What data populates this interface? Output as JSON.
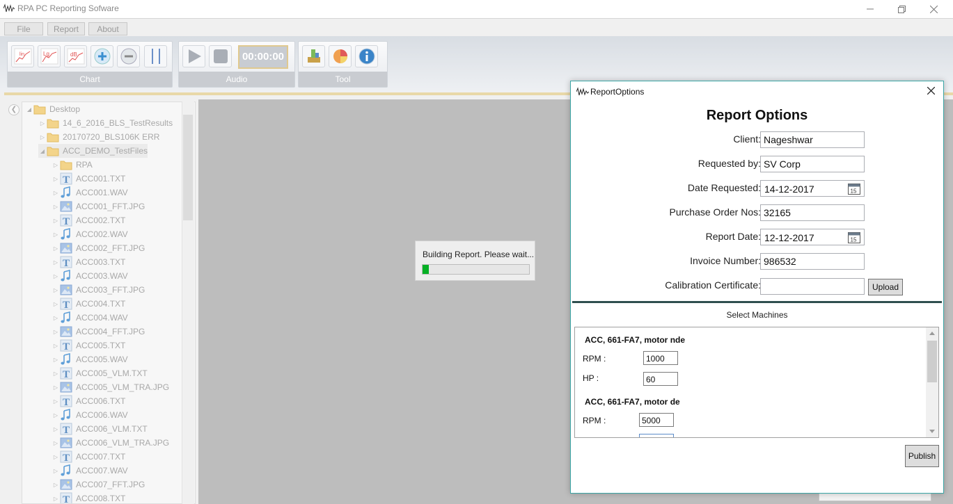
{
  "window": {
    "title": "RPA PC Reporting Sofware",
    "icon": "waveform-icon"
  },
  "menu": [
    "File",
    "Report",
    "About"
  ],
  "ribbon": {
    "chart_label": "Chart",
    "audio_label": "Audio",
    "tool_label": "Tool",
    "timer": "00:00:00",
    "chart_buttons": [
      {
        "icon": "linear-scale-icon",
        "text": "lin"
      },
      {
        "icon": "log-scale-icon",
        "text": "Lg"
      },
      {
        "icon": "db-scale-icon",
        "text": "dB"
      },
      {
        "icon": "zoom-in-icon"
      },
      {
        "icon": "zoom-out-icon"
      },
      {
        "icon": "cursor-lines-icon"
      }
    ]
  },
  "tree": {
    "root": "Desktop",
    "folders": [
      "14_6_2016_BLS_TestResults",
      "20170720_BLS106K ERR",
      "ACC_DEMO_TestFiles"
    ],
    "subfolder": "RPA",
    "files": [
      {
        "name": "ACC001.TXT",
        "type": "txt"
      },
      {
        "name": "ACC001.WAV",
        "type": "wav"
      },
      {
        "name": "ACC001_FFT.JPG",
        "type": "jpg"
      },
      {
        "name": "ACC002.TXT",
        "type": "txt"
      },
      {
        "name": "ACC002.WAV",
        "type": "wav"
      },
      {
        "name": "ACC002_FFT.JPG",
        "type": "jpg"
      },
      {
        "name": "ACC003.TXT",
        "type": "txt"
      },
      {
        "name": "ACC003.WAV",
        "type": "wav"
      },
      {
        "name": "ACC003_FFT.JPG",
        "type": "jpg"
      },
      {
        "name": "ACC004.TXT",
        "type": "txt"
      },
      {
        "name": "ACC004.WAV",
        "type": "wav"
      },
      {
        "name": "ACC004_FFT.JPG",
        "type": "jpg"
      },
      {
        "name": "ACC005.TXT",
        "type": "txt"
      },
      {
        "name": "ACC005.WAV",
        "type": "wav"
      },
      {
        "name": "ACC005_VLM.TXT",
        "type": "txt"
      },
      {
        "name": "ACC005_VLM_TRA.JPG",
        "type": "jpg"
      },
      {
        "name": "ACC006.TXT",
        "type": "txt"
      },
      {
        "name": "ACC006.WAV",
        "type": "wav"
      },
      {
        "name": "ACC006_VLM.TXT",
        "type": "txt"
      },
      {
        "name": "ACC006_VLM_TRA.JPG",
        "type": "jpg"
      },
      {
        "name": "ACC007.TXT",
        "type": "txt"
      },
      {
        "name": "ACC007.WAV",
        "type": "wav"
      },
      {
        "name": "ACC007_FFT.JPG",
        "type": "jpg"
      },
      {
        "name": "ACC008.TXT",
        "type": "txt"
      }
    ]
  },
  "progress": {
    "message": "Building Report. Please wait...",
    "fraction": 0.06,
    "color": "#06b025"
  },
  "dialog": {
    "title": "ReportOptions",
    "heading": "Report Options",
    "fields": {
      "client": {
        "label": "Client:",
        "value": "Nageshwar"
      },
      "requested_by": {
        "label": "Requested by:",
        "value": "SV Corp"
      },
      "date_requested": {
        "label": "Date Requested:",
        "value": "14-12-2017"
      },
      "po_nos": {
        "label": "Purchase Order Nos:",
        "value": "32165"
      },
      "report_date": {
        "label": "Report Date:",
        "value": "12-12-2017"
      },
      "invoice": {
        "label": "Invoice Number:",
        "value": "986532"
      },
      "calibration": {
        "label": "Calibration Certificate:",
        "value": ""
      }
    },
    "calendar_day": "15",
    "upload_label": "Upload",
    "select_machines_label": "Select Machines",
    "machines": [
      {
        "name": "ACC, 661-FA7, motor nde",
        "rpm_label": "RPM :",
        "rpm": "1000",
        "hp_label": "HP :",
        "hp": "60"
      },
      {
        "name": "ACC, 661-FA7, motor de",
        "rpm_label": "RPM :",
        "rpm": "5000"
      }
    ],
    "publish_label": "Publish",
    "accent_color": "#3aa6a6"
  }
}
